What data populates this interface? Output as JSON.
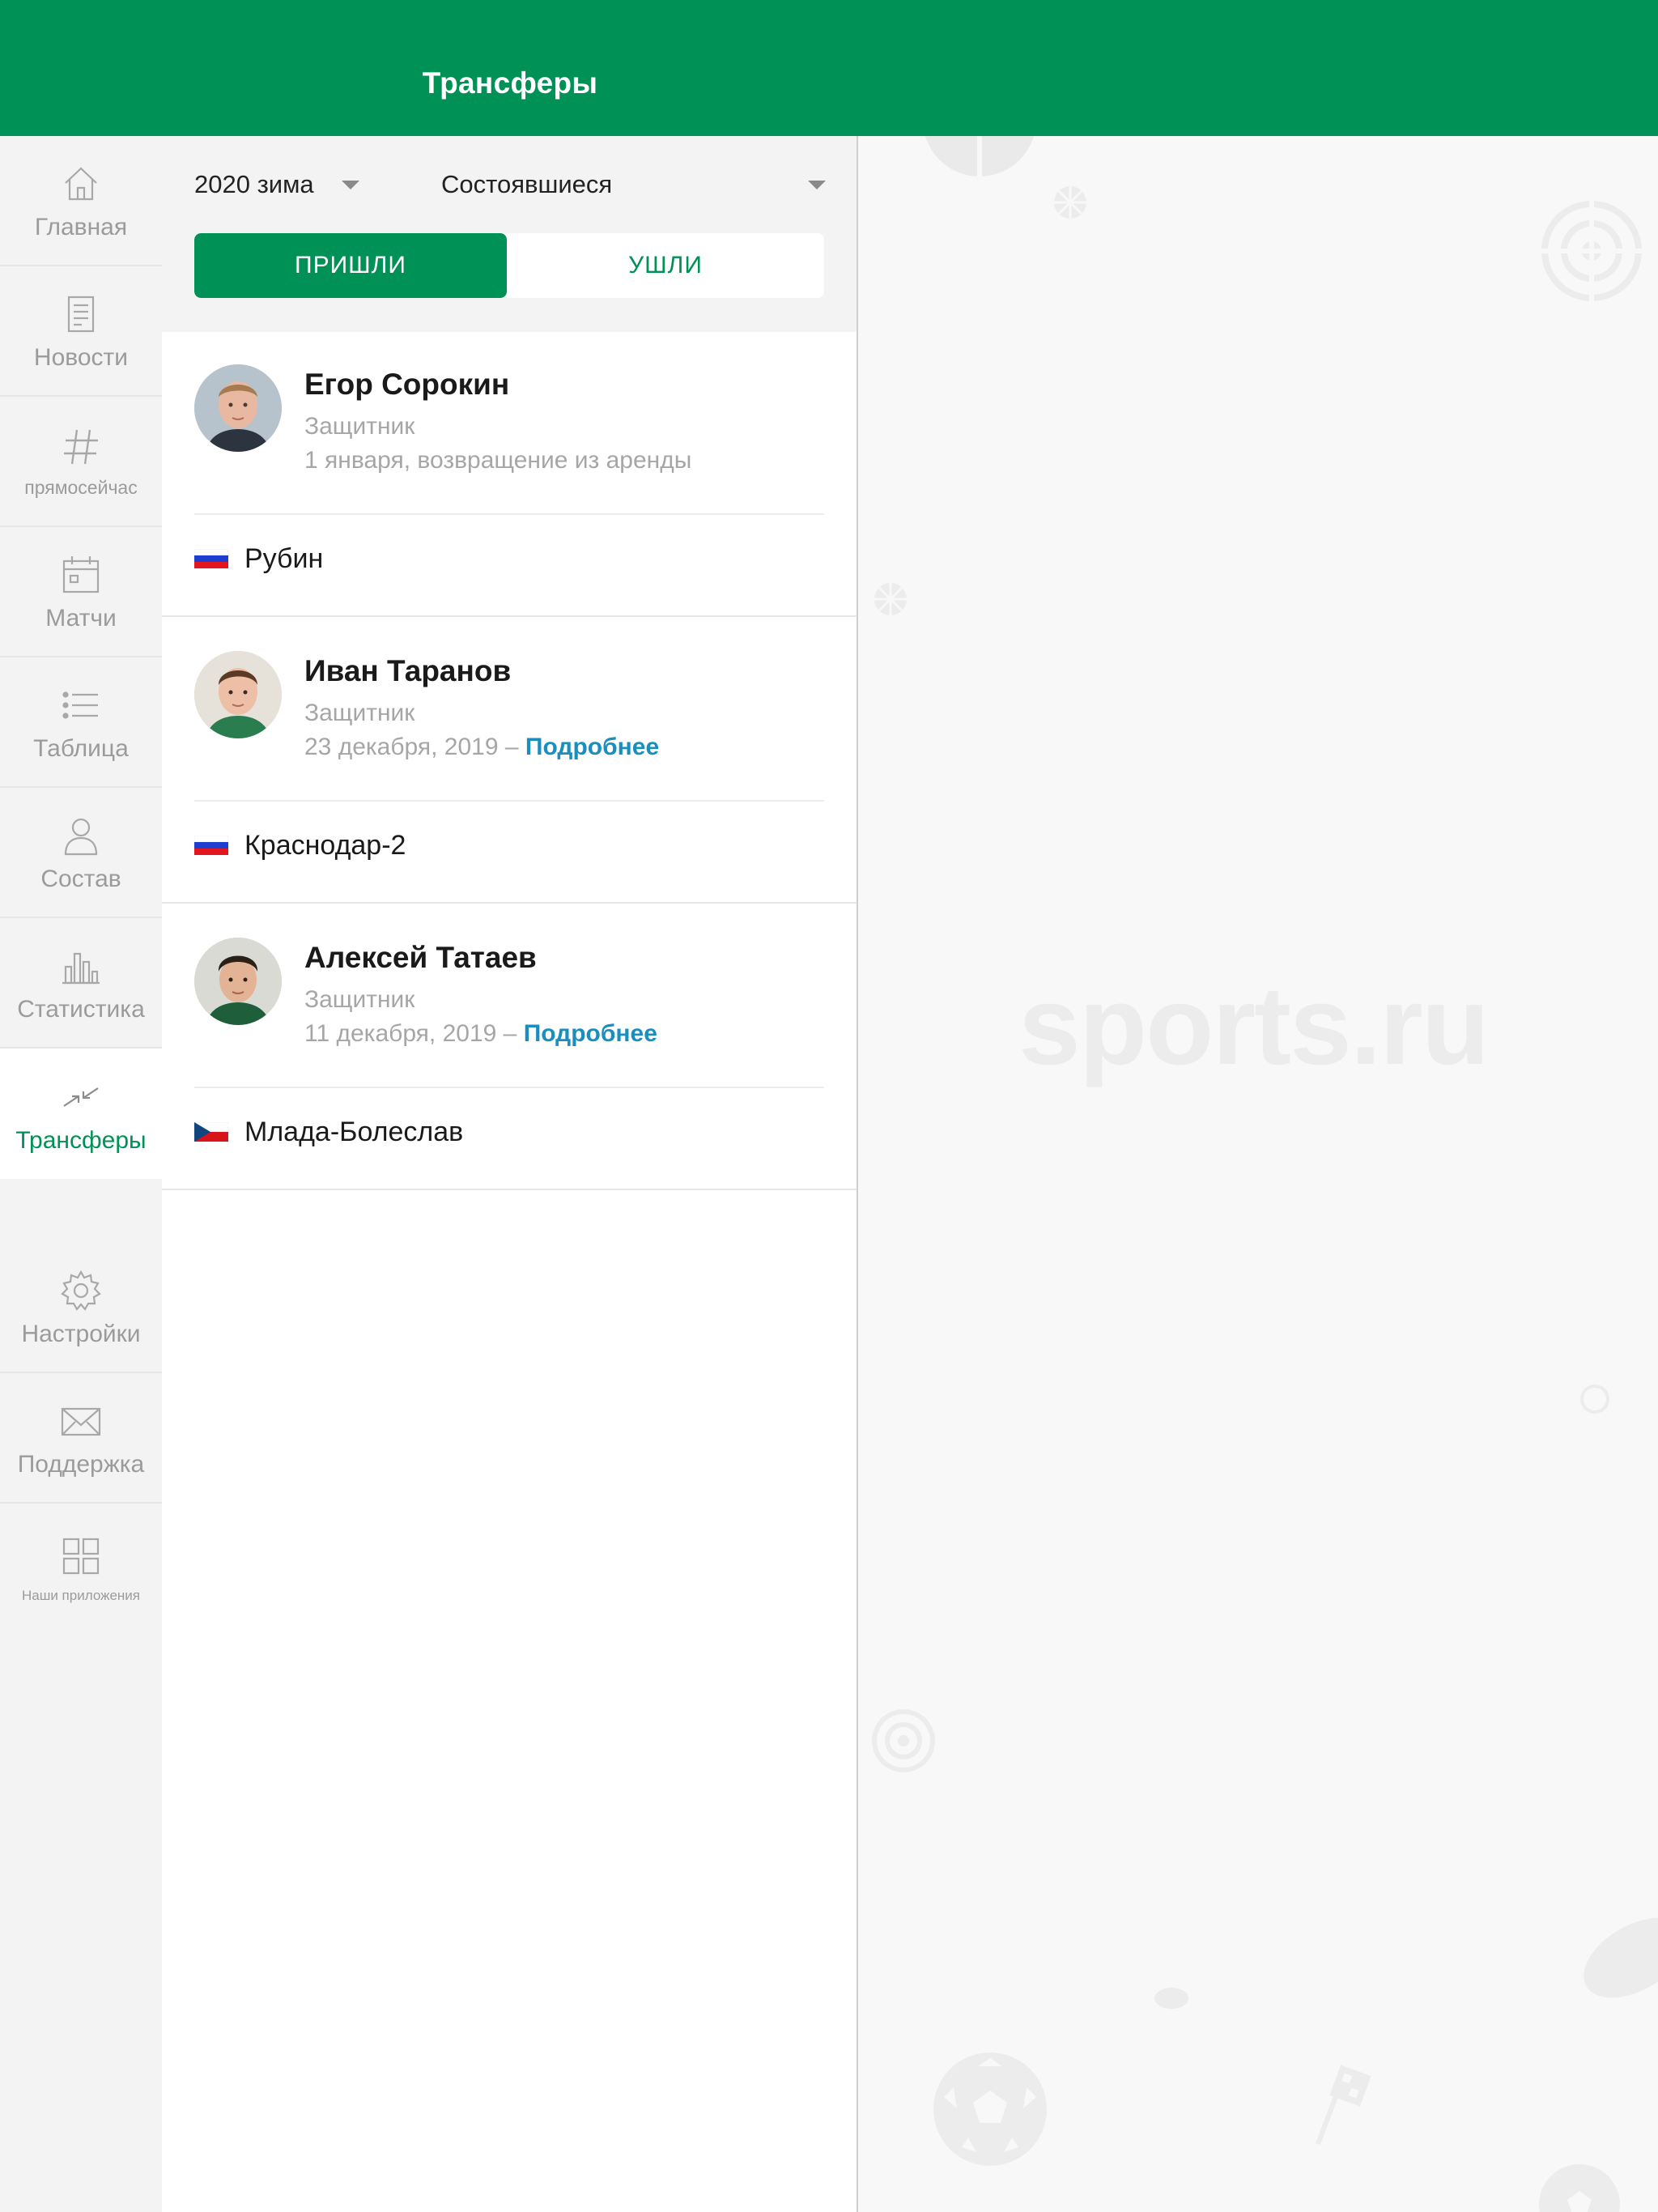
{
  "header": {
    "title": "Трансферы"
  },
  "sidebar": {
    "items": [
      {
        "label": "Главная",
        "icon": "home-icon"
      },
      {
        "label": "Новости",
        "icon": "news-icon"
      },
      {
        "label": "прямосейчас",
        "icon": "hashtag-icon"
      },
      {
        "label": "Матчи",
        "icon": "calendar-icon"
      },
      {
        "label": "Таблица",
        "icon": "list-icon"
      },
      {
        "label": "Состав",
        "icon": "person-icon"
      },
      {
        "label": "Статистика",
        "icon": "bar-chart-icon"
      },
      {
        "label": "Трансферы",
        "icon": "transfer-arrows-icon",
        "active": true
      },
      {
        "label": "Настройки",
        "icon": "gear-icon"
      },
      {
        "label": "Поддержка",
        "icon": "envelope-icon"
      },
      {
        "label": "Наши приложения",
        "icon": "apps-grid-icon"
      }
    ]
  },
  "filters": {
    "season": "2020 зима",
    "status": "Состоявшиеся",
    "tabs": {
      "incoming": "ПРИШЛИ",
      "outgoing": "УШЛИ",
      "selected": "ПРИШЛИ"
    }
  },
  "transfers": [
    {
      "name": "Егор Сорокин",
      "position": "Защитник",
      "detail": "1 января, возвращение из аренды",
      "more": "",
      "club": "Рубин",
      "flag": "russia-flag"
    },
    {
      "name": "Иван Таранов",
      "position": "Защитник",
      "detail": "23 декабря, 2019 –",
      "more": "Подробнее",
      "club": "Краснодар-2",
      "flag": "russia-flag"
    },
    {
      "name": "Алексей Татаев",
      "position": "Защитник",
      "detail": "11 декабря, 2019 –",
      "more": "Подробнее",
      "club": "Млада-Болеслав",
      "flag": "czech-flag"
    }
  ],
  "watermark": "sports.ru",
  "colors": {
    "brand": "#009157",
    "link": "#1a8fbf",
    "muted": "#a6a6a6"
  }
}
